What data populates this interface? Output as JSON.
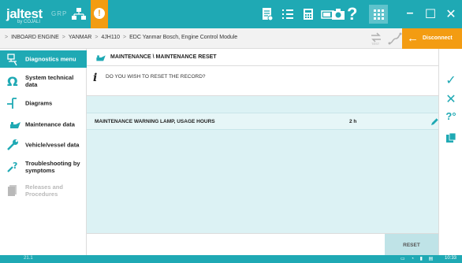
{
  "app": {
    "logo_text": "jaltest",
    "logo_sub": "by COJALI",
    "group_label": "GRP"
  },
  "breadcrumb": {
    "items": [
      "INBOARD ENGINE",
      "YANMAR",
      "4JH110",
      "EDC Yanmar Bosch, Engine Control Module"
    ]
  },
  "toolbar": {
    "alert_symbol": "!",
    "help_symbol": "?",
    "minimize_symbol": "–",
    "maximize_symbol": "☐",
    "close_symbol": "✕",
    "disconnect_label": "Disconnect",
    "disconnect_arrow": "←"
  },
  "sidebar": {
    "items": [
      {
        "label": "Diagnostics menu",
        "icon": "diagnostics-menu-icon",
        "state": "active"
      },
      {
        "label": "System technical data",
        "icon": "omega-icon",
        "state": "normal"
      },
      {
        "label": "Diagrams",
        "icon": "diagram-icon",
        "state": "normal"
      },
      {
        "label": "Maintenance data",
        "icon": "oil-can-icon",
        "state": "normal"
      },
      {
        "label": "Vehicle/vessel data",
        "icon": "wrench-icon",
        "state": "normal"
      },
      {
        "label": "Troubleshooting by symptoms",
        "icon": "troubleshoot-icon",
        "state": "normal"
      },
      {
        "label": "Releases and Procedures",
        "icon": "document-icon",
        "state": "disabled"
      }
    ],
    "back_symbol": "‹"
  },
  "main": {
    "header": "MAINTENANCE \\ MAINTENANCE RESET",
    "prompt": "DO YOU WISH TO RESET THE RECORD?",
    "rows": [
      {
        "name": "MAINTENANCE WARNING LAMP, USAGE HOURS",
        "value": "2 h"
      }
    ],
    "reset_label": "RESET"
  },
  "rightbar": {
    "confirm_symbol": "✓",
    "cancel_symbol": "✕",
    "help_symbol": "?°"
  },
  "statusbar": {
    "version": "21.1",
    "time": "10:33"
  },
  "colors": {
    "accent": "#1fa9b4",
    "warning": "#f39c12",
    "row_bg": "#e6f6f7"
  }
}
